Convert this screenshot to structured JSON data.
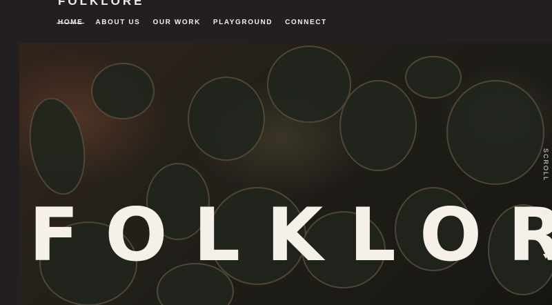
{
  "site": {
    "logo_text": "FOLKLORE"
  },
  "nav": {
    "items": [
      {
        "label": "HOME",
        "active": true
      },
      {
        "label": "ABOUT US",
        "active": false
      },
      {
        "label": "OUR WORK",
        "active": false
      },
      {
        "label": "PLAYGROUND",
        "active": false
      },
      {
        "label": "CONNECT",
        "active": false
      }
    ]
  },
  "hero": {
    "title": "FOLKLOR",
    "scroll_label": "SCROLL",
    "scroll_up_icon": "triangle-up-icon",
    "scroll_down_icon": "triangle-down-icon",
    "image": "cactus-photo"
  },
  "colors": {
    "background": "#231f21",
    "text": "#f3efe6"
  }
}
